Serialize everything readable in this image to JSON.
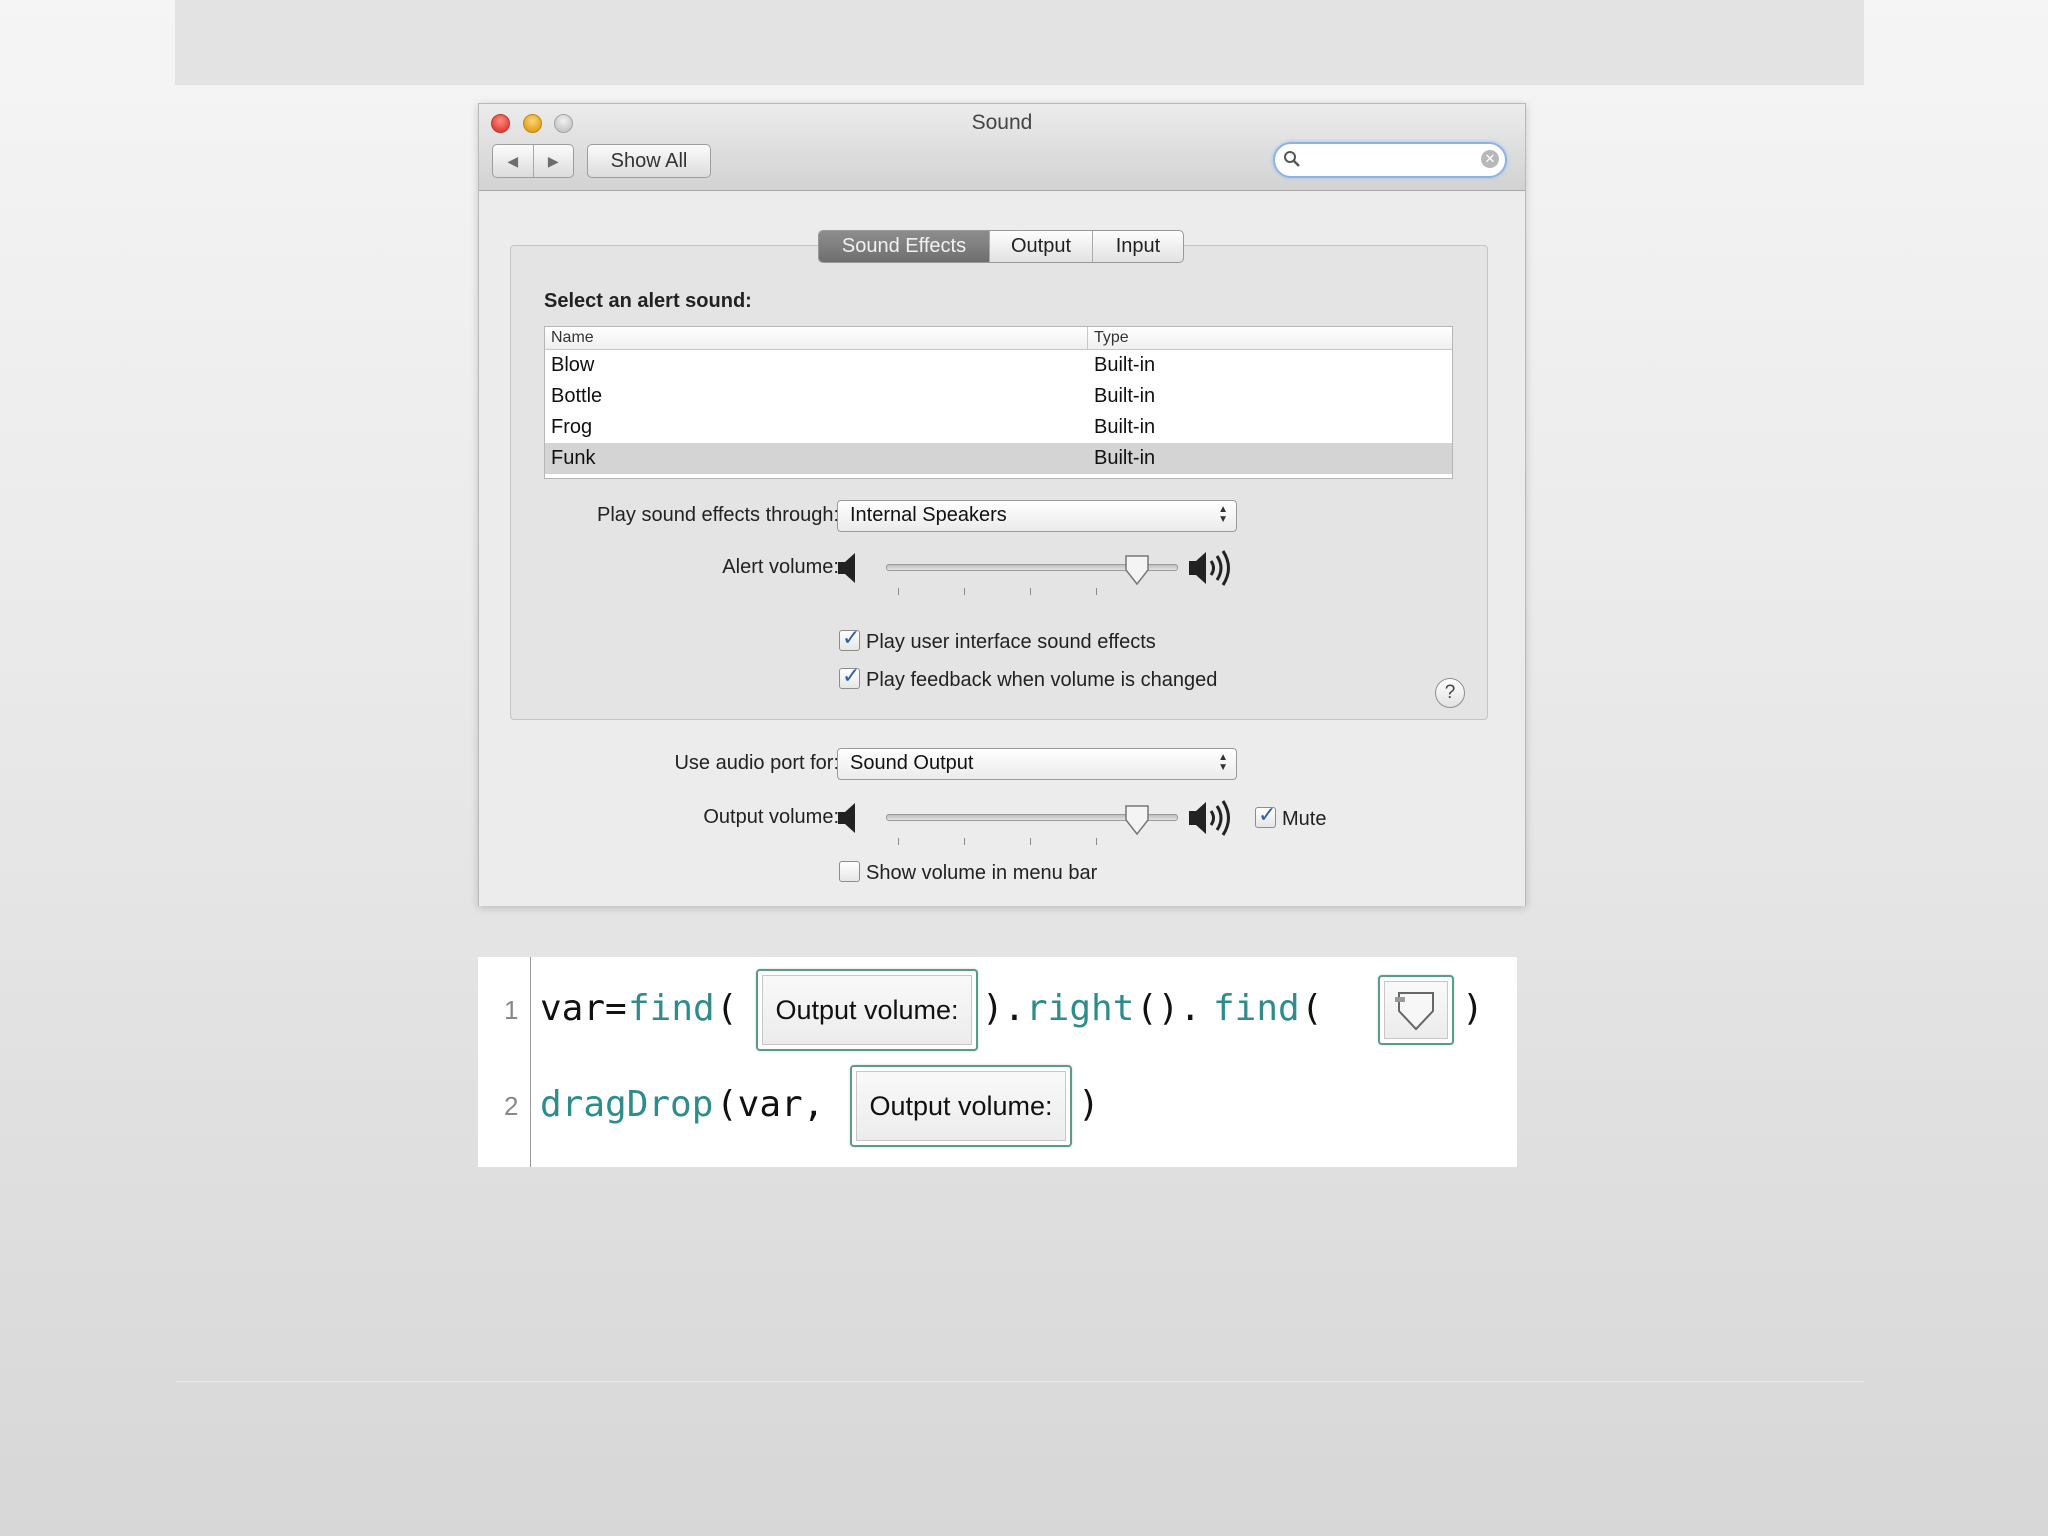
{
  "window": {
    "title": "Sound",
    "nav_back": "◀",
    "nav_forward": "▶",
    "show_all": "Show All",
    "search_value": ""
  },
  "tabs": [
    "Sound Effects",
    "Output",
    "Input"
  ],
  "active_tab": "Sound Effects",
  "sound_effects": {
    "select_label": "Select an alert sound:",
    "columns": [
      "Name",
      "Type"
    ],
    "rows": [
      {
        "name": "Blow",
        "type": "Built-in"
      },
      {
        "name": "Bottle",
        "type": "Built-in"
      },
      {
        "name": "Frog",
        "type": "Built-in"
      },
      {
        "name": "Funk",
        "type": "Built-in"
      }
    ],
    "selected_row": "Funk",
    "play_through_label": "Play sound effects through:",
    "play_through_value": "Internal Speakers",
    "alert_volume_label": "Alert volume:",
    "alert_volume_level": 0.9,
    "ui_sounds_label": "Play user interface sound effects",
    "ui_sounds_checked": true,
    "feedback_label": "Play feedback when volume is changed",
    "feedback_checked": true,
    "help": "?"
  },
  "output": {
    "audio_port_label": "Use audio port for:",
    "audio_port_value": "Sound Output",
    "output_volume_label": "Output volume:",
    "output_volume_level": 0.9,
    "mute_label": "Mute",
    "mute_checked": true,
    "menu_bar_label": "Show volume in menu bar",
    "menu_bar_checked": false
  },
  "code": {
    "line_numbers": [
      "1",
      "2"
    ],
    "line1": {
      "t1": "var=",
      "t2": "find",
      "t3": "(",
      "shot": "Output volume:",
      "t4": ").",
      "t5": "right",
      "t6": "().",
      "t7": "find",
      "t8": "(",
      "t9": ")"
    },
    "line2": {
      "t1": "dragDrop",
      "t2": "(var,",
      "shot": "Output volume:",
      "t3": ")"
    }
  },
  "colors": {
    "code_function": "#2f8c8c",
    "screenshot_border": "#5b9c86",
    "search_focus": "#8cb3e2",
    "checkbox_mark": "#2d5fa8"
  }
}
